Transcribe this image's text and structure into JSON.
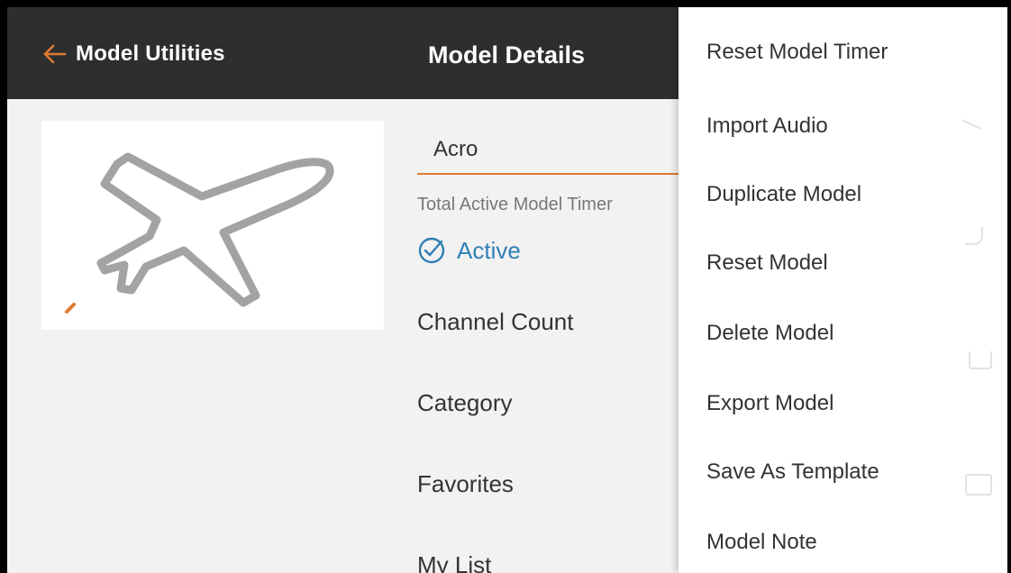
{
  "header": {
    "back_label": "Model Utilities",
    "title": "Model Details",
    "accent_color": "#e07a33"
  },
  "details": {
    "thumbnail_icon": "airplane-icon",
    "model_name": "Acro",
    "timer_label": "Total Active Model Timer",
    "active_label": "Active",
    "rows": [
      "Channel Count",
      "Category",
      "Favorites",
      "My List"
    ]
  },
  "menu": {
    "items": [
      "Reset Model Timer",
      "Import Audio",
      "Duplicate Model",
      "Reset Model",
      "Delete Model",
      "Export Model",
      "Save As Template",
      "Model Note"
    ]
  }
}
